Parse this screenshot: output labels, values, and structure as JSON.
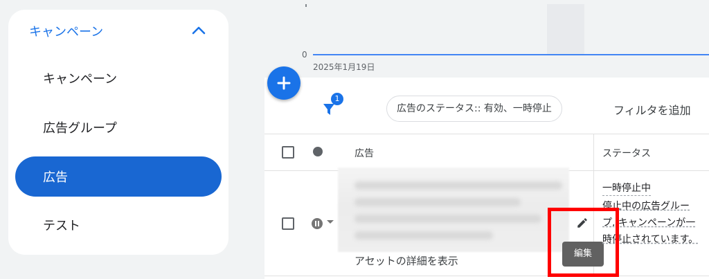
{
  "sidebar": {
    "section_label": "キャンペーン",
    "items": [
      {
        "label": "キャンペーン"
      },
      {
        "label": "広告グループ"
      },
      {
        "label": "広告",
        "active": true
      },
      {
        "label": "テスト"
      }
    ]
  },
  "chart": {
    "zero_label": "0",
    "date_label": "2025年1月19日"
  },
  "toolbar": {
    "filter_badge": "1",
    "filter_chip": "広告のステータス:: 有効、一時停止",
    "add_filter": "フィルタを追加"
  },
  "table": {
    "columns": [
      "広告",
      "ステータス"
    ],
    "rows": [
      {
        "asset_link": "アセットの詳細を表示",
        "status_main": "一時停止中",
        "status_detail": "停止中の広告グループ, キャンペーンが一時停止されています。"
      }
    ]
  },
  "tooltip": {
    "edit": "編集"
  },
  "colors": {
    "accent": "#1a73e8",
    "active_nav": "#1967d2",
    "highlight": "#ff0000"
  },
  "icons": [
    "chevron-up-icon",
    "add-icon",
    "filter-icon",
    "pause-icon",
    "dropdown-arrow-icon",
    "edit-pencil-icon"
  ]
}
